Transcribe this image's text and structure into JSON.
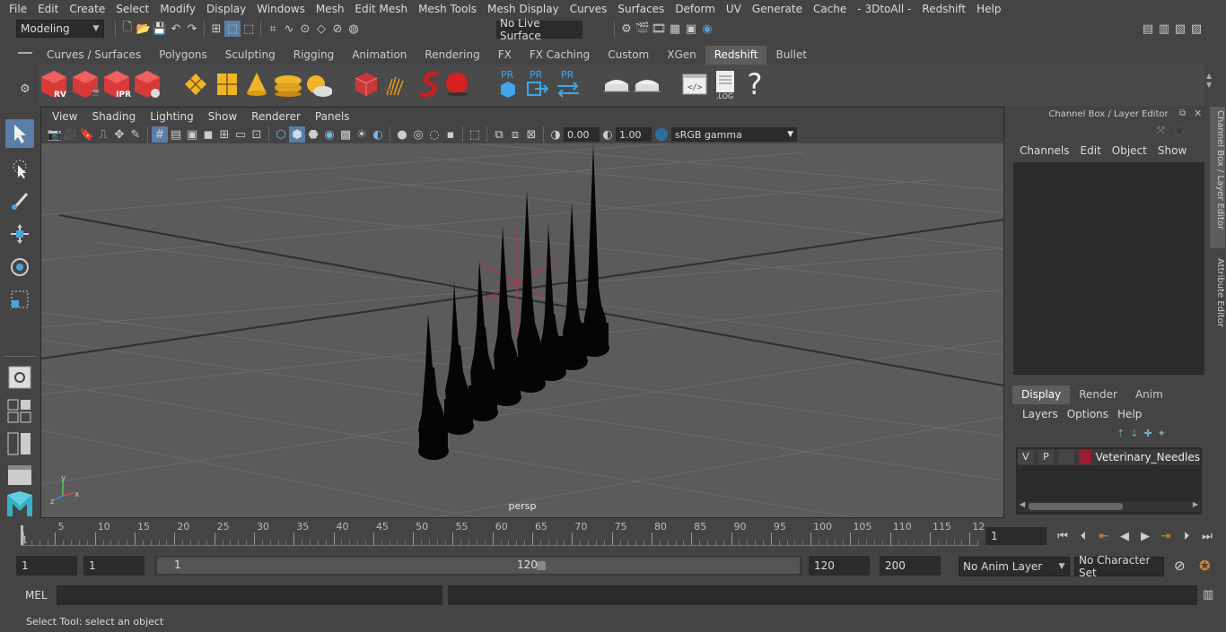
{
  "menubar": {
    "items": [
      "File",
      "Edit",
      "Create",
      "Select",
      "Modify",
      "Display",
      "Windows",
      "Mesh",
      "Edit Mesh",
      "Mesh Tools",
      "Mesh Display",
      "Curves",
      "Surfaces",
      "Deform",
      "UV",
      "Generate",
      "Cache",
      "- 3DtoAll -",
      "Redshift",
      "Help"
    ]
  },
  "statusline": {
    "mode": "Modeling",
    "live_surface": "No Live Surface"
  },
  "shelf": {
    "tabs": [
      "Curves / Surfaces",
      "Polygons",
      "Sculpting",
      "Rigging",
      "Animation",
      "Rendering",
      "FX",
      "FX Caching",
      "Custom",
      "XGen",
      "Redshift",
      "Bullet"
    ],
    "active_tab": "Redshift",
    "labels": {
      "rv": "RV",
      "ipr": "IPR",
      "pr1": "PR",
      "pr2": "PR",
      "pr3": "PR",
      "log": ".LOG",
      "help": "?"
    }
  },
  "viewport": {
    "menu": [
      "View",
      "Shading",
      "Lighting",
      "Show",
      "Renderer",
      "Panels"
    ],
    "exposure": "0.00",
    "gamma": "1.00",
    "color_space": "sRGB gamma",
    "camera_label": "persp",
    "axis": {
      "x": "x",
      "y": "y",
      "z": "z"
    }
  },
  "channelbox": {
    "title": "Channel Box / Layer Editor",
    "menu": [
      "Channels",
      "Edit",
      "Object",
      "Show"
    ],
    "layer_tabs": [
      "Display",
      "Render",
      "Anim"
    ],
    "layer_menu": [
      "Layers",
      "Options",
      "Help"
    ],
    "layers": [
      {
        "v": "V",
        "p": "P",
        "color": "#9b1b30",
        "name": "Veterinary_Needles"
      }
    ]
  },
  "sidetabs": [
    "Channel Box / Layer Editor",
    "Attribute Editor"
  ],
  "timeline": {
    "ticks": [
      "1",
      "5",
      "10",
      "15",
      "20",
      "25",
      "30",
      "35",
      "40",
      "45",
      "50",
      "55",
      "60",
      "65",
      "70",
      "75",
      "80",
      "85",
      "90",
      "95",
      "100",
      "105",
      "110",
      "115",
      "12"
    ],
    "current_frame": "1"
  },
  "range": {
    "start": "1",
    "playback_start": "1",
    "slider_start": "1",
    "slider_end": "120",
    "playback_end": "120",
    "end": "200",
    "anim_layer": "No Anim Layer",
    "character_set": "No Character Set"
  },
  "mel": {
    "label": "MEL"
  },
  "help_line": "Select Tool: select an object"
}
